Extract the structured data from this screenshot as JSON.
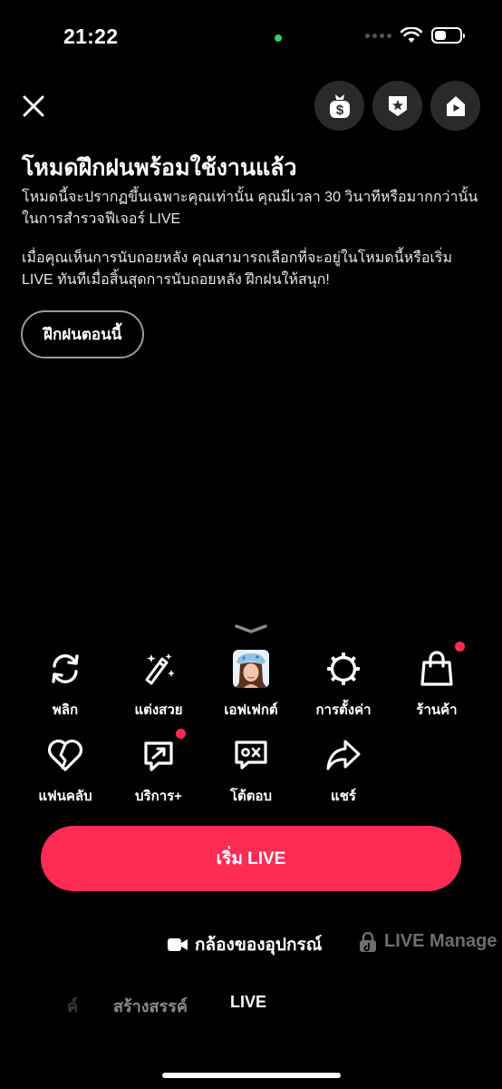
{
  "status_bar": {
    "time": "21:22",
    "battery_level": 0.45
  },
  "header": {
    "close_icon": "close-icon",
    "top_buttons": [
      {
        "icon": "money-bag-icon"
      },
      {
        "icon": "star-badge-icon"
      },
      {
        "icon": "home-play-icon"
      }
    ]
  },
  "practice_mode": {
    "title": "โหมดฝึกฝนพร้อมใช้งานแล้ว",
    "description_1": "โหมดนี้จะปรากฏขึ้นเฉพาะคุณเท่านั้น คุณมีเวลา 30 วินาทีหรือมากกว่านั้นในการสำรวจฟีเจอร์ LIVE",
    "description_2": "เมื่อคุณเห็นการนับถอยหลัง คุณสามารถเลือกที่จะอยู่ในโหมดนี้หรือเริ่ม LIVE ทันทีเมื่อสิ้นสุดการนับถอยหลัง ฝึกฝนให้สนุก!",
    "button_label": "ฝึกฝนตอนนี้"
  },
  "tools_row1": [
    {
      "label": "พลิก",
      "icon": "flip-camera-icon",
      "badge": false
    },
    {
      "label": "แต่งสวย",
      "icon": "magic-wand-icon",
      "badge": false
    },
    {
      "label": "เอฟเฟกต์",
      "icon": "effect-thumbnail-icon",
      "badge": false
    },
    {
      "label": "การตั้งค่า",
      "icon": "settings-icon",
      "badge": false
    },
    {
      "label": "ร้านค้า",
      "icon": "shopping-bag-icon",
      "badge": true
    }
  ],
  "tools_row2": [
    {
      "label": "แฟนคลับ",
      "icon": "fan-club-heart-icon",
      "badge": false
    },
    {
      "label": "บริการ+",
      "icon": "service-plus-icon",
      "badge": true
    },
    {
      "label": "โต้ตอบ",
      "icon": "interact-chat-icon",
      "badge": false
    },
    {
      "label": "แชร์",
      "icon": "share-arrow-icon",
      "badge": false
    }
  ],
  "go_live_label": "เริ่ม LIVE",
  "source_options": {
    "camera_label": "กล้องของอุปกรณ์",
    "manager_label": "LIVE Manage"
  },
  "mode_tabs": {
    "partial": "ค์",
    "create": "สร้างสรรค์",
    "live": "LIVE"
  },
  "colors": {
    "accent": "#fe2c55",
    "background": "#000000",
    "status_dot": "#30d158"
  }
}
